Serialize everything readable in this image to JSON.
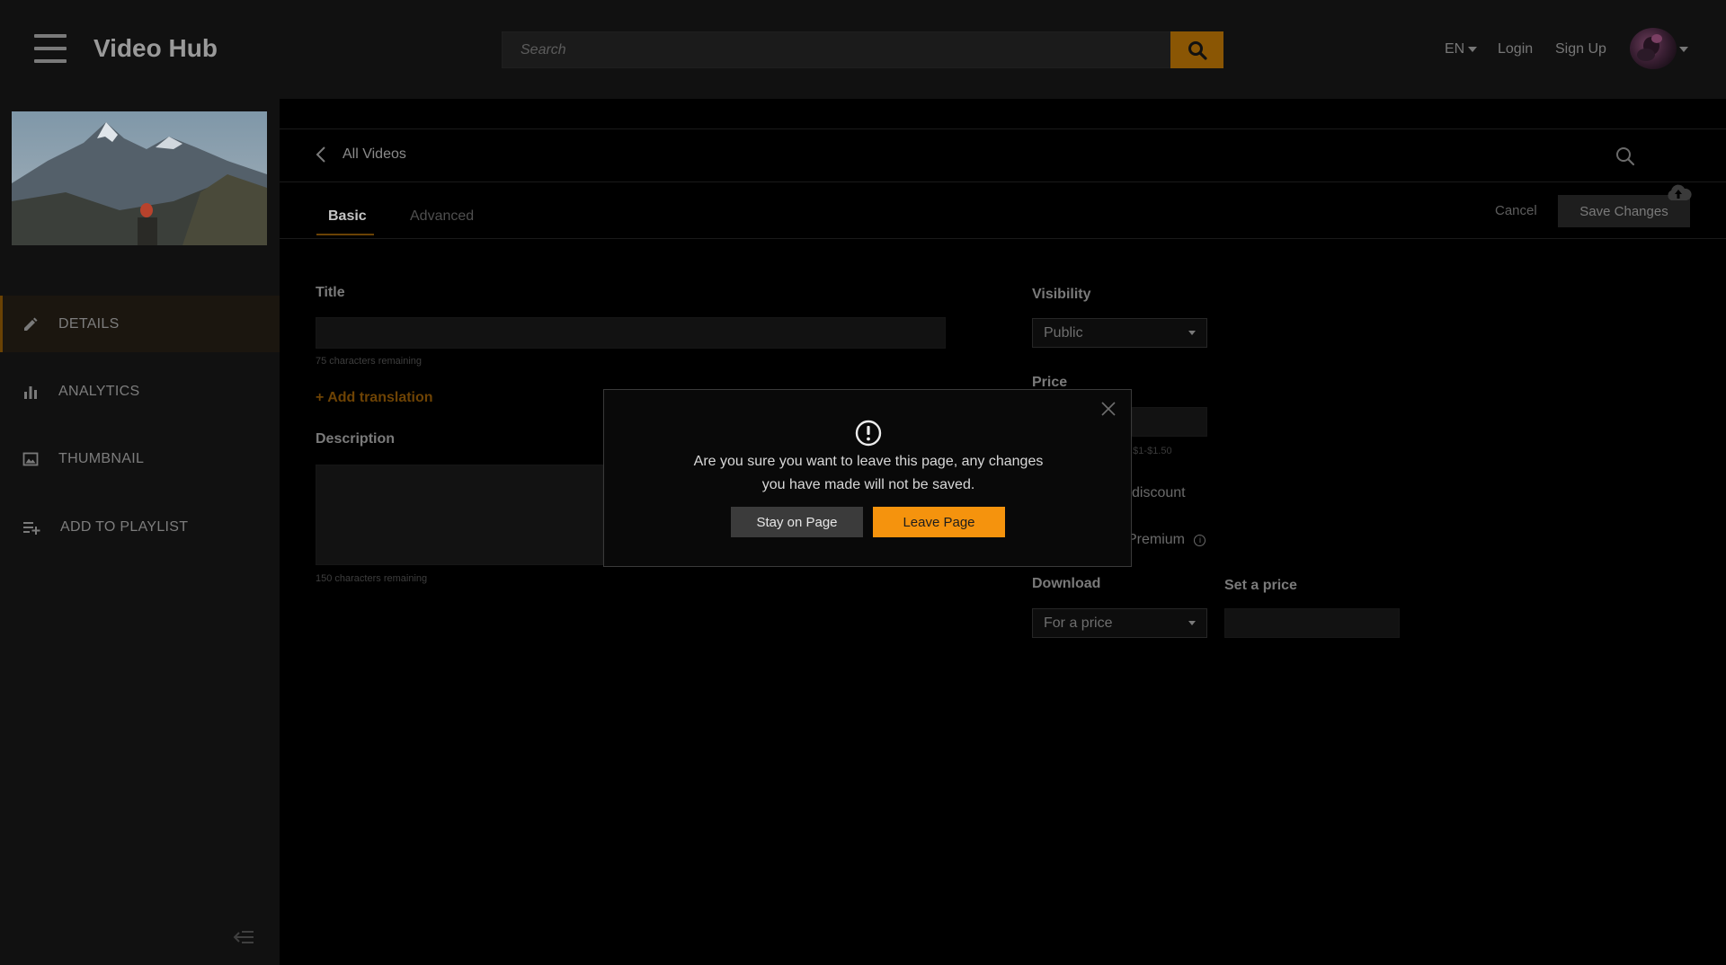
{
  "header": {
    "brand": "Video Hub",
    "search_placeholder": "Search",
    "language": "EN",
    "login": "Login",
    "signup": "Sign Up",
    "accent_color": "#f5930d"
  },
  "sidebar": {
    "items": [
      {
        "label": "DETAILS",
        "icon": "pencil-icon",
        "active": true
      },
      {
        "label": "ANALYTICS",
        "icon": "bar-chart-icon",
        "active": false
      },
      {
        "label": "THUMBNAIL",
        "icon": "image-icon",
        "active": false
      },
      {
        "label": "ADD TO PLAYLIST",
        "icon": "playlist-add-icon",
        "active": false
      }
    ]
  },
  "main": {
    "back_label": "All Videos",
    "tabs": [
      {
        "label": "Basic",
        "active": true
      },
      {
        "label": "Advanced",
        "active": false
      }
    ],
    "cancel": "Cancel",
    "save": "Save Changes",
    "form": {
      "title_label": "Title",
      "title_value": "",
      "title_hint": "75 characters remaining",
      "add_translation": "+ Add translation",
      "description_label": "Description",
      "description_value": "",
      "description_hint": "150 characters remaining",
      "visibility_label": "Visibility",
      "visibility_value": "Public",
      "price_label": "Price",
      "price_hint_partial": "n $1-$1.50",
      "discount_partial": "discount",
      "premium_partial": "Premium",
      "download_label": "Download",
      "download_value": "For a price",
      "set_price_label": "Set a price",
      "set_price_value": ""
    }
  },
  "modal": {
    "message_line1": "Are you sure you want to leave this page, any changes",
    "message_line2": "you have made will not be saved.",
    "stay": "Stay on Page",
    "leave": "Leave Page"
  }
}
